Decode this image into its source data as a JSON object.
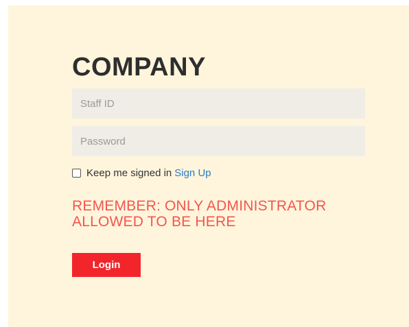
{
  "brand": "COMPANY",
  "form": {
    "staff_id_placeholder": "Staff ID",
    "password_placeholder": "Password",
    "remember_label": "Keep me signed in",
    "remember_checked": false,
    "signup_label": "Sign Up",
    "warning_line1": "REMEMBER: ONLY ADMINISTRATOR",
    "warning_line2": "ALLOWED TO BE HERE",
    "login_label": "Login"
  },
  "colors": {
    "background": "#fff5dc",
    "input_background": "#efede6",
    "link": "#2a7bc4",
    "warning": "#f2564e",
    "button": "#f2252b"
  }
}
